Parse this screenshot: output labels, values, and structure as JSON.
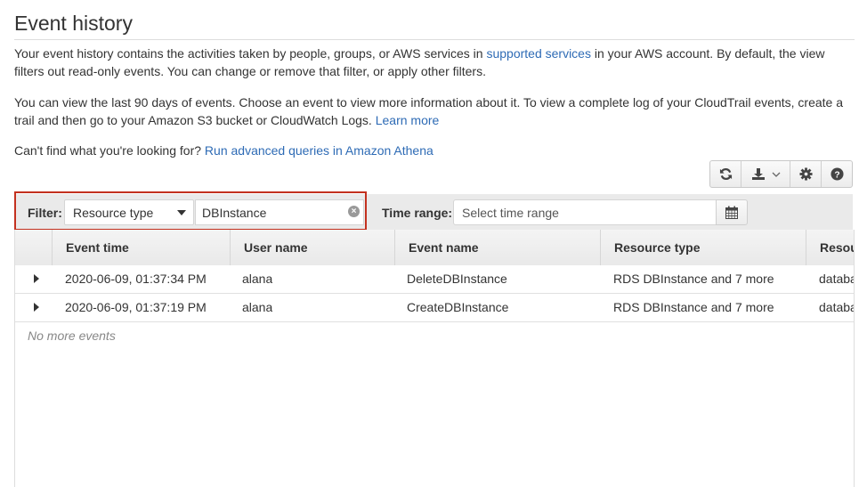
{
  "page": {
    "title": "Event history",
    "intro": {
      "p1_before": "Your event history contains the activities taken by people, groups, or AWS services in ",
      "p1_link": "supported services",
      "p1_after": " in your AWS account. By default, the view filters out read-only events. You can change or remove that filter, or apply other filters.",
      "p2_before": "You can view the last 90 days of events. Choose an event to view more information about it. To view a complete log of your CloudTrail events, create a trail and then go to your Amazon S3 bucket or CloudWatch Logs. ",
      "p2_link": "Learn more",
      "p3_before": "Can't find what you're looking for? ",
      "p3_link": "Run advanced queries in Amazon Athena"
    }
  },
  "toolbar": {
    "buttons": [
      {
        "name": "refresh",
        "icon": "refresh-icon"
      },
      {
        "name": "download",
        "icon": "download-icon"
      },
      {
        "name": "settings",
        "icon": "gear-icon"
      },
      {
        "name": "help",
        "icon": "help-icon"
      }
    ]
  },
  "filter": {
    "label": "Filter:",
    "attribute_selected": "Resource type",
    "value": "DBInstance",
    "highlight_color": "#c3311f"
  },
  "time_range": {
    "label": "Time range:",
    "placeholder": "Select time range"
  },
  "table": {
    "columns": [
      "Event time",
      "User name",
      "Event name",
      "Resource type",
      "Resource name"
    ],
    "columns_visible": [
      "Event time",
      "User name",
      "Event name",
      "Resource type",
      "Resou"
    ],
    "rows": [
      {
        "event_time": "2020-06-09, 01:37:34 PM",
        "user_name": "alana",
        "event_name": "DeleteDBInstance",
        "resource_type": "RDS DBInstance and 7 more",
        "resource_name": "databa"
      },
      {
        "event_time": "2020-06-09, 01:37:19 PM",
        "user_name": "alana",
        "event_name": "CreateDBInstance",
        "resource_type": "RDS DBInstance and 7 more",
        "resource_name": "databa"
      }
    ],
    "footer": "No more events"
  },
  "colors": {
    "link": "#2e6bb5",
    "text": "#333333"
  }
}
